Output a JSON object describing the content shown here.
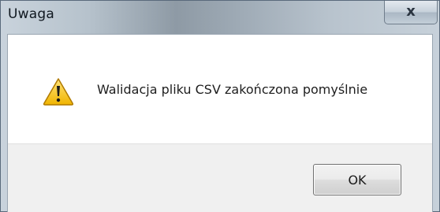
{
  "window": {
    "title": "Uwaga",
    "close_glyph": "x"
  },
  "dialog": {
    "icon": "warning-icon",
    "message": "Walidacja pliku CSV zakończona pomyślnie",
    "ok_label": "OK"
  },
  "colors": {
    "warning_fill": "#f5c400",
    "warning_outline": "#b07a00"
  }
}
